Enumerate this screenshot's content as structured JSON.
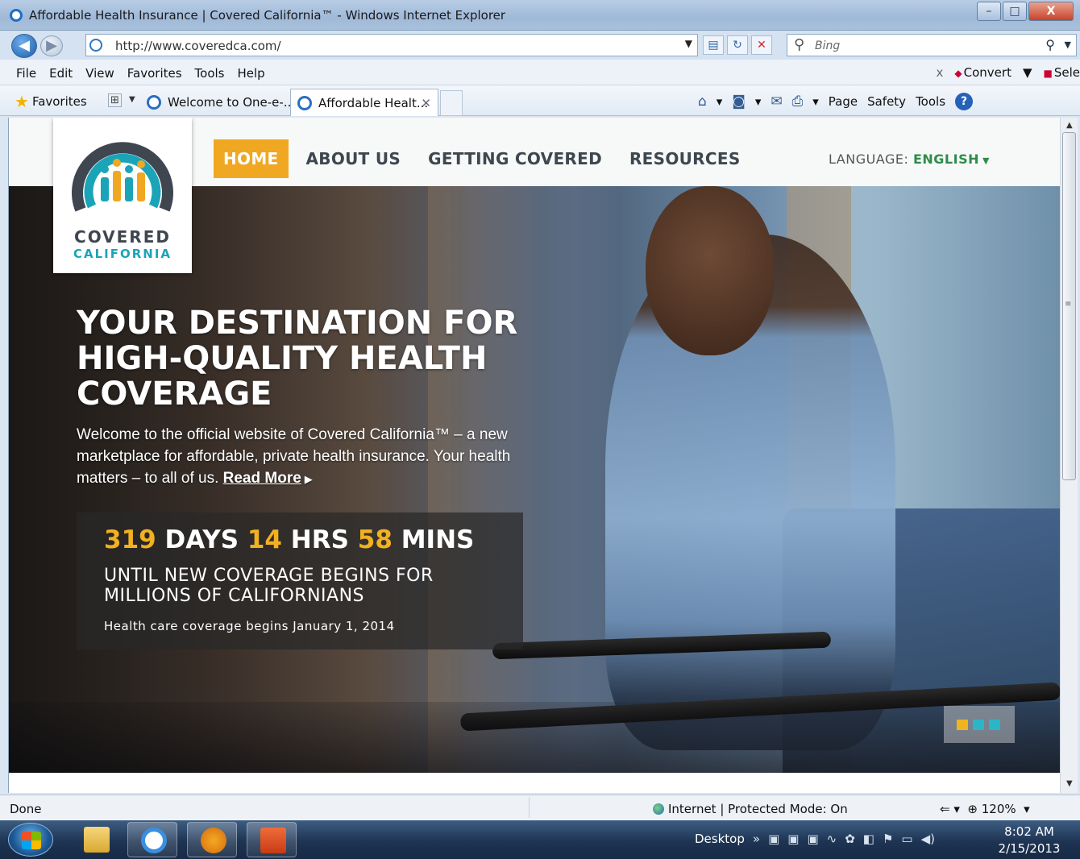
{
  "window": {
    "title": "Affordable Health Insurance | Covered California™ - Windows Internet Explorer",
    "minimize": "–",
    "maximize": "□",
    "close": "X"
  },
  "address_bar": {
    "url": "http://www.coveredca.com/",
    "search_placeholder": "Bing"
  },
  "menu": {
    "items": [
      "File",
      "Edit",
      "View",
      "Favorites",
      "Tools",
      "Help"
    ],
    "right_close": "x",
    "convert": "Convert",
    "select": "Sele"
  },
  "favorites_bar": {
    "favorites_label": "Favorites",
    "tabs": [
      {
        "label": "Welcome to One-e-..."
      },
      {
        "label": "Affordable Healt..."
      }
    ],
    "commands": [
      "Page",
      "Safety",
      "Tools"
    ]
  },
  "site": {
    "logo": {
      "line1": "COVERED",
      "line2": "CALIFORNIA"
    },
    "nav": [
      "HOME",
      "ABOUT US",
      "GETTING COVERED",
      "RESOURCES"
    ],
    "language_label": "LANGUAGE:",
    "language_value": "ENGLISH",
    "hero": {
      "headline": "YOUR DESTINATION FOR HIGH-QUALITY HEALTH COVERAGE",
      "intro": "Welcome to the official website of Covered California™ – a new marketplace for affordable, private health insurance. Your health matters – to all of us.",
      "read_more": "Read More",
      "countdown": {
        "days": "319",
        "days_label": "DAYS",
        "hrs": "14",
        "hrs_label": "HRS",
        "mins": "58",
        "mins_label": "MINS",
        "subtitle": "UNTIL NEW COVERAGE BEGINS FOR MILLIONS OF CALIFORNIANS",
        "note": "Health care coverage begins January 1, 2014"
      }
    }
  },
  "status_bar": {
    "status": "Done",
    "zone": "Internet | Protected Mode: On",
    "zoom": "120%"
  },
  "taskbar": {
    "desktop_label": "Desktop",
    "time": "8:02 AM",
    "date": "2/15/2013"
  },
  "colors": {
    "accent_orange": "#f0a722",
    "countdown_gold": "#f2b120",
    "logo_teal": "#1ba4b8",
    "language_green": "#2e8c4a"
  }
}
